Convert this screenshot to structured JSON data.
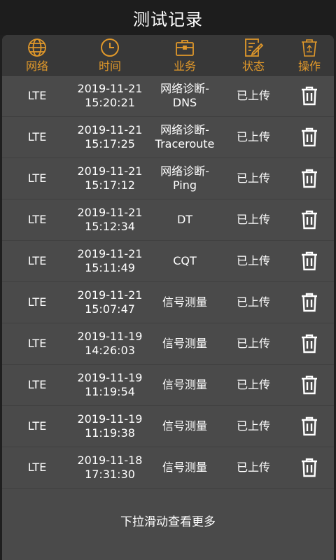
{
  "app": {
    "title": "测试记录"
  },
  "header": {
    "network": "网络",
    "time": "时间",
    "business": "业务",
    "status": "状态",
    "action": "操作"
  },
  "records": [
    {
      "network": "LTE",
      "date": "2019-11-21",
      "time": "15:20:21",
      "biz_line1": "网络诊断-",
      "biz_line2": "DNS",
      "status": "已上传"
    },
    {
      "network": "LTE",
      "date": "2019-11-21",
      "time": "15:17:25",
      "biz_line1": "网络诊断-",
      "biz_line2": "Traceroute",
      "status": "已上传"
    },
    {
      "network": "LTE",
      "date": "2019-11-21",
      "time": "15:17:12",
      "biz_line1": "网络诊断-",
      "biz_line2": "Ping",
      "status": "已上传"
    },
    {
      "network": "LTE",
      "date": "2019-11-21",
      "time": "15:12:34",
      "biz_line1": "DT",
      "biz_line2": "",
      "status": "已上传"
    },
    {
      "network": "LTE",
      "date": "2019-11-21",
      "time": "15:11:49",
      "biz_line1": "CQT",
      "biz_line2": "",
      "status": "已上传"
    },
    {
      "network": "LTE",
      "date": "2019-11-21",
      "time": "15:07:47",
      "biz_line1": "信号测量",
      "biz_line2": "",
      "status": "已上传"
    },
    {
      "network": "LTE",
      "date": "2019-11-19",
      "time": "14:26:03",
      "biz_line1": "信号测量",
      "biz_line2": "",
      "status": "已上传"
    },
    {
      "network": "LTE",
      "date": "2019-11-19",
      "time": "11:19:54",
      "biz_line1": "信号测量",
      "biz_line2": "",
      "status": "已上传"
    },
    {
      "network": "LTE",
      "date": "2019-11-19",
      "time": "11:19:38",
      "biz_line1": "信号测量",
      "biz_line2": "",
      "status": "已上传"
    },
    {
      "network": "LTE",
      "date": "2019-11-18",
      "time": "17:31:30",
      "biz_line1": "信号测量",
      "biz_line2": "",
      "status": "已上传"
    }
  ],
  "footer": {
    "load_more": "下拉滑动查看更多"
  },
  "colors": {
    "accent": "#e0982a",
    "panel": "#4a4a4a",
    "header": "#383838",
    "topbar": "#1d1d1d"
  },
  "icons": {
    "network": "globe-icon",
    "time": "clock-icon",
    "business": "briefcase-icon",
    "status": "edit-doc-icon",
    "action": "recycle-bin-icon",
    "row_action": "trash-icon"
  }
}
